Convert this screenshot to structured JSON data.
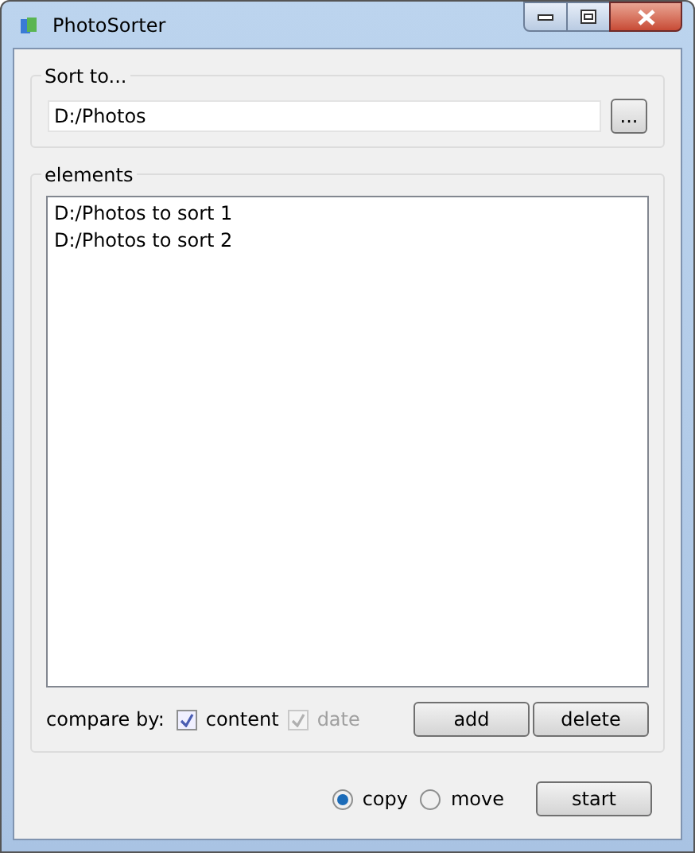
{
  "window": {
    "title": "PhotoSorter"
  },
  "sort_to": {
    "label": "Sort to...",
    "value": "D:/Photos",
    "browse_button": "..."
  },
  "elements": {
    "label": "elements",
    "items": [
      "D:/Photos to sort 1",
      "D:/Photos to sort 2"
    ],
    "compare_label": "compare by:",
    "options": [
      {
        "label": "content",
        "checked": true,
        "disabled": false
      },
      {
        "label": "date",
        "checked": true,
        "disabled": true
      }
    ],
    "buttons": [
      "add",
      "delete"
    ]
  },
  "modes": [
    {
      "label": "copy",
      "selected": true
    },
    {
      "label": "move",
      "selected": false
    }
  ],
  "start_button": "start"
}
